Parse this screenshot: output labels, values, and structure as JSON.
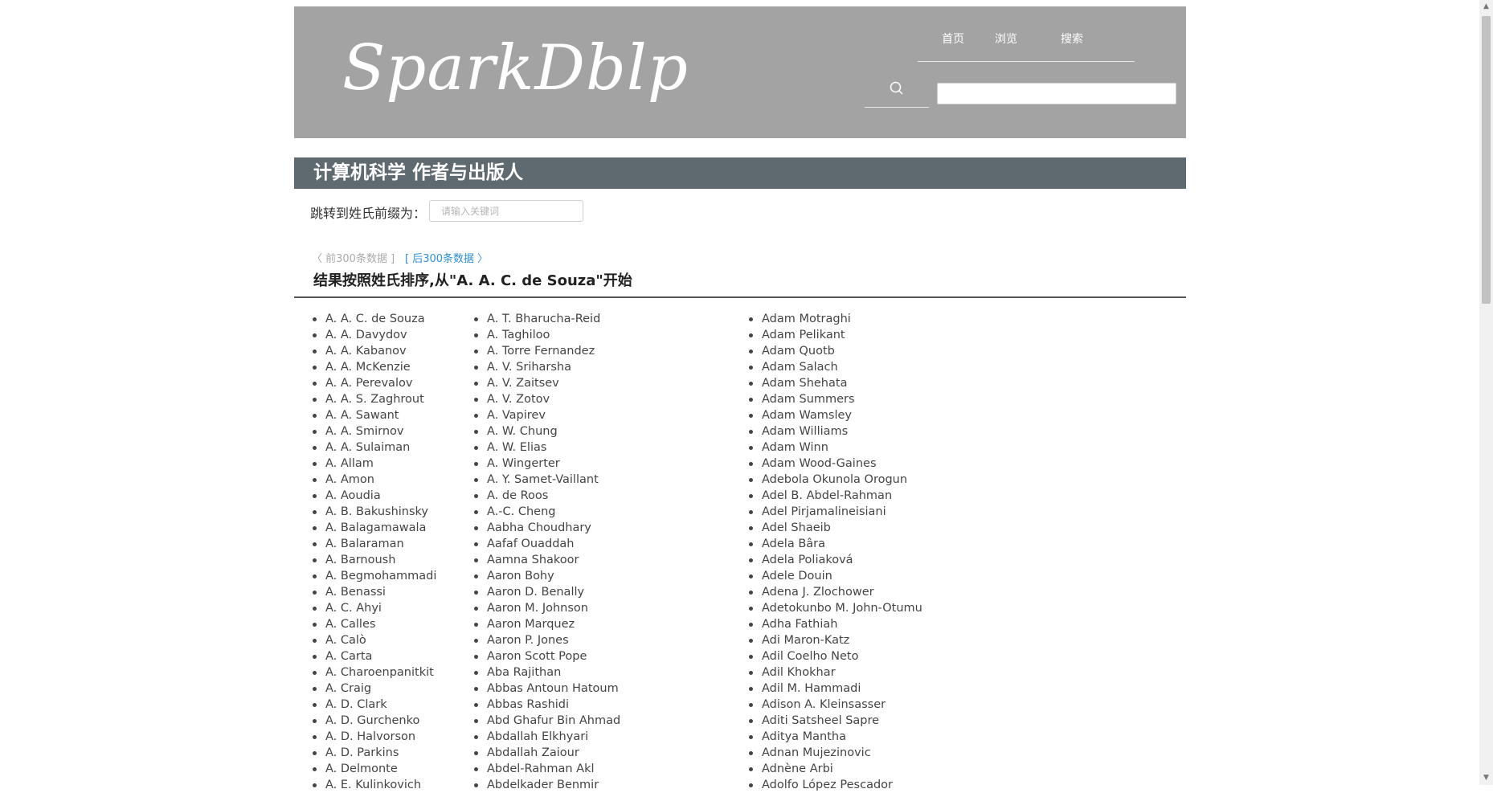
{
  "header": {
    "logo": "SparkDblp",
    "nav": [
      "首页",
      "浏览",
      "搜索"
    ],
    "search_value": ""
  },
  "title_bar": "计算机科学 作者与出版人",
  "jump": {
    "label": "跳转到姓氏前缀为：",
    "placeholder": "请输入关键词"
  },
  "pager": {
    "prev": "〈 前300条数据 ]",
    "next": "[ 后300条数据 〉"
  },
  "result_heading": "结果按照姓氏排序,从\"A. A. C. de Souza\"开始",
  "columns": [
    [
      "A. A. C. de Souza",
      "A. A. Davydov",
      "A. A. Kabanov",
      "A. A. McKenzie",
      "A. A. Perevalov",
      "A. A. S. Zaghrout",
      "A. A. Sawant",
      "A. A. Smirnov",
      "A. A. Sulaiman",
      "A. Allam",
      "A. Amon",
      "A. Aoudia",
      "A. B. Bakushinsky",
      "A. Balagamawala",
      "A. Balaraman",
      "A. Barnoush",
      "A. Begmohammadi",
      "A. Benassi",
      "A. C. Ahyi",
      "A. Calles",
      "A. Calò",
      "A. Carta",
      "A. Charoenpanitkit",
      "A. Craig",
      "A. D. Clark",
      "A. D. Gurchenko",
      "A. D. Halvorson",
      "A. D. Parkins",
      "A. Delmonte",
      "A. E. Kulinkovich"
    ],
    [
      "A. T. Bharucha-Reid",
      "A. Taghiloo",
      "A. Torre Fernandez",
      "A. V. Sriharsha",
      "A. V. Zaitsev",
      "A. V. Zotov",
      "A. Vapirev",
      "A. W. Chung",
      "A. W. Elias",
      "A. Wingerter",
      "A. Y. Samet-Vaillant",
      "A. de Roos",
      "A.-C. Cheng",
      "Aabha Choudhary",
      "Aafaf Ouaddah",
      "Aamna Shakoor",
      "Aaron Bohy",
      "Aaron D. Benally",
      "Aaron M. Johnson",
      "Aaron Marquez",
      "Aaron P. Jones",
      "Aaron Scott Pope",
      "Aba Rajithan",
      "Abbas Antoun Hatoum",
      "Abbas Rashidi",
      "Abd Ghafur Bin Ahmad",
      "Abdallah Elkhyari",
      "Abdallah Zaiour",
      "Abdel-Rahman Akl",
      "Abdelkader Benmir"
    ],
    [
      "Adam Motraghi",
      "Adam Pelikant",
      "Adam Quotb",
      "Adam Salach",
      "Adam Shehata",
      "Adam Summers",
      "Adam Wamsley",
      "Adam Williams",
      "Adam Winn",
      "Adam Wood-Gaines",
      "Adebola Okunola Orogun",
      "Adel B. Abdel-Rahman",
      "Adel Pirjamalineisiani",
      "Adel Shaeib",
      "Adela Bâra",
      "Adela Poliaková",
      "Adele Douin",
      "Adena J. Zlochower",
      "Adetokunbo M. John-Otumu",
      "Adha Fathiah",
      "Adi Maron-Katz",
      "Adil Coelho Neto",
      "Adil Khokhar",
      "Adil M. Hammadi",
      "Adison A. Kleinsasser",
      "Aditi Satsheel Sapre",
      "Aditya Mantha",
      "Adnan Mujezinovic",
      "Adnène Arbi",
      "Adolfo López Pescador"
    ]
  ]
}
